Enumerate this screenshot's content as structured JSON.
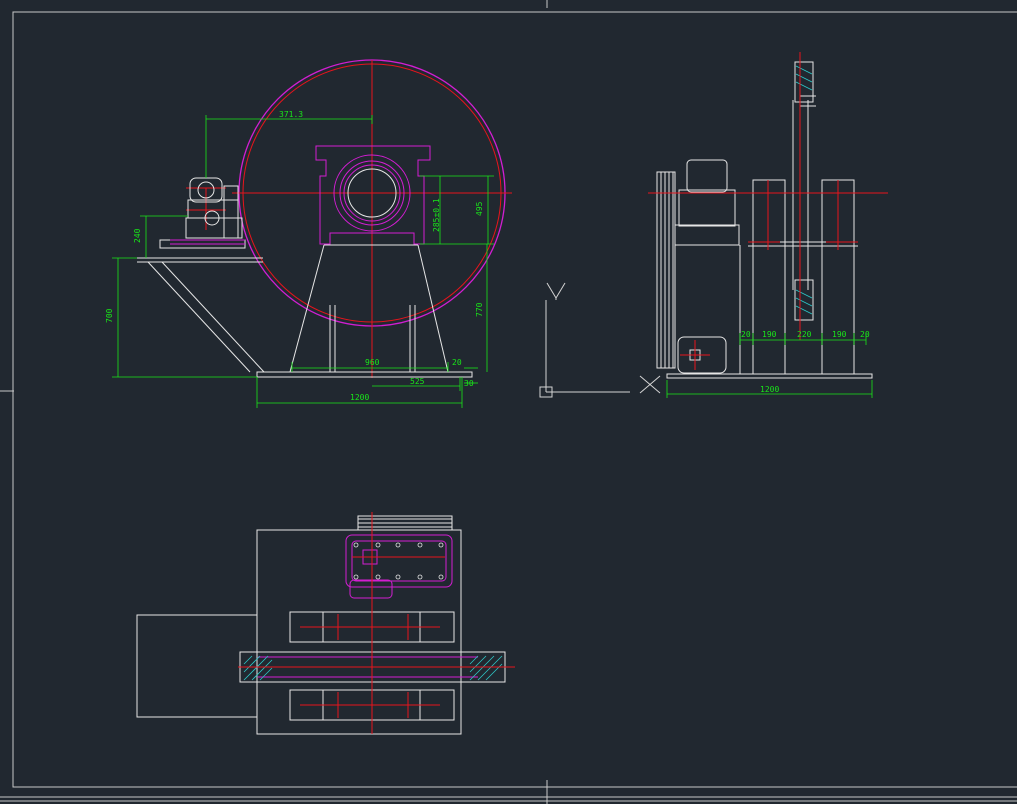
{
  "colors": {
    "background": "#212830",
    "outline": "#e6e6e6",
    "center_line": "#e8141c",
    "dimension": "#19e619",
    "magenta": "#d21ed2",
    "hatch": "#2ec8c8"
  },
  "front_view": {
    "dims": {
      "top_width": "371.3",
      "gear_height": "495",
      "bore": "285±0.1",
      "left_height": "700",
      "right_height": "770",
      "motor_base": "240",
      "base_span": "960",
      "base_right_offset": "525",
      "small_a": "20",
      "small_b": "30",
      "overall_base": "1200"
    }
  },
  "side_view": {
    "dims": {
      "d1": "20",
      "d2": "190",
      "d3": "220",
      "d4": "190",
      "d5": "20",
      "overall": "1200"
    }
  },
  "ucs_icon": {
    "x_label": "X",
    "y_label": "Y"
  }
}
